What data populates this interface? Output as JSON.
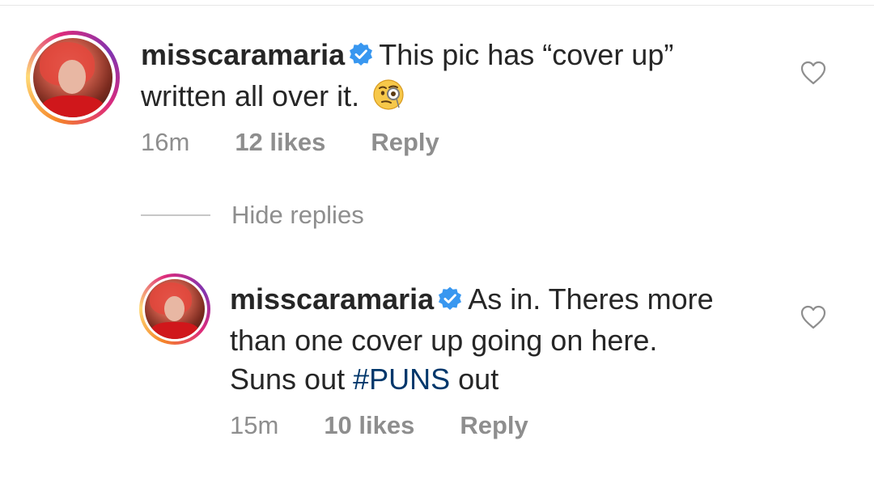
{
  "comments": [
    {
      "username": "misscaramaria",
      "verified": true,
      "text_line1": "This pic has “cover up”",
      "text_line2": "written all over it.",
      "emoji": "monocle-face",
      "time": "16m",
      "likes": "12 likes",
      "reply_label": "Reply"
    }
  ],
  "hide_replies_label": "Hide replies",
  "replies": [
    {
      "username": "misscaramaria",
      "verified": true,
      "text_line1": "As in. Theres more",
      "text_line2": "than one cover up going on here.",
      "text_line3_prefix": "Suns out ",
      "hashtag": "#PUNS",
      "text_line3_suffix": " out",
      "time": "15m",
      "likes": "10 likes",
      "reply_label": "Reply"
    }
  ],
  "colors": {
    "username": "#262626",
    "meta": "#8e8e8e",
    "hashtag": "#00376b",
    "verified": "#3897f0"
  },
  "icons": [
    "verified-badge-icon",
    "heart-outline-icon",
    "monocle-face-emoji"
  ]
}
